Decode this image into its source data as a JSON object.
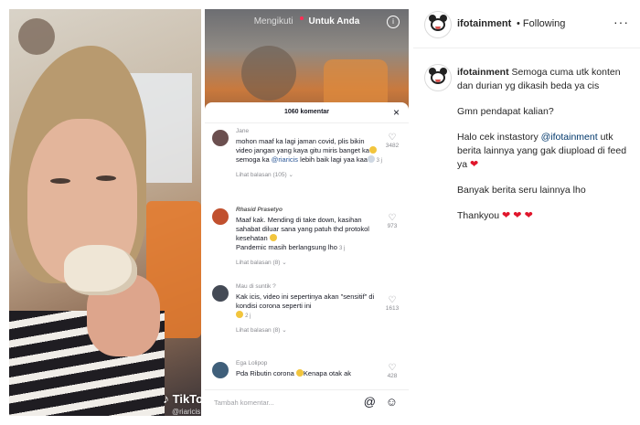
{
  "left_photo": {
    "watermark": "TikTok",
    "handle": "@riaricis"
  },
  "tiktok": {
    "tabs": {
      "following": "Mengikuti",
      "for_you": "Untuk Anda"
    },
    "comments_header": "1060 komentar",
    "close": "×",
    "comments": [
      {
        "name": "Jane",
        "text_parts": [
          "mohon maaf ka lagi jaman covid, plis bikin video jangan yang kaya gitu miris banget ka",
          " semoga ka ",
          "@riaricis",
          " lebih baik lagi yaa kaa",
          " 3 j"
        ],
        "replies": "Lihat balasan (105)",
        "likes": "3482",
        "avatar_color": "#6b4f4f"
      },
      {
        "name": "Rhasid Prasetyo",
        "text": "Maaf kak. Mending di take down, kasihan sahabat diluar sana yang patuh thd protokol kesehatan",
        "text2": "Pandemic masih berlangsung lho",
        "time": "3 j",
        "replies": "Lihat balasan (8)",
        "likes": "973",
        "avatar_color": "#c1502e"
      },
      {
        "name": "Mau di suntik ?",
        "text": "Kak icis, video ini sepertinya akan \"sensitif\" di kondisi corona seperti ini",
        "time": "2 j",
        "replies": "Lihat balasan (8)",
        "likes": "1613",
        "avatar_color": "#444a55"
      },
      {
        "name": "Ega Lolipop",
        "text": "Pda Ributin corona",
        "text2": "Kenapa otak ak",
        "likes": "428",
        "avatar_color": "#3f5f7a"
      }
    ],
    "input_placeholder": "Tambah komentar...",
    "at_icon": "@",
    "emoji_icon": "☺"
  },
  "instagram": {
    "username": "ifotainment",
    "following": "• Following",
    "more": "···",
    "caption_username": "ifotainment",
    "caption_line1": "Semoga cuma utk konten dan durian yg dikasih beda ya cis",
    "para2": "Gmn pendapat kalian?",
    "para3_before": "Halo cek instastory ",
    "para3_mention": "@ifotainment",
    "para3_after": " utk berita lainnya yang gak diupload di feed ya ",
    "para4": "Banyak berita seru lainnya lho",
    "para5": "Thankyou ",
    "heart": "❤",
    "hearts3": "❤ ❤ ❤",
    "colors": {
      "mention": "#00376b",
      "heart": "#e0152b",
      "tiktok_dot": "#ff2d55"
    }
  }
}
